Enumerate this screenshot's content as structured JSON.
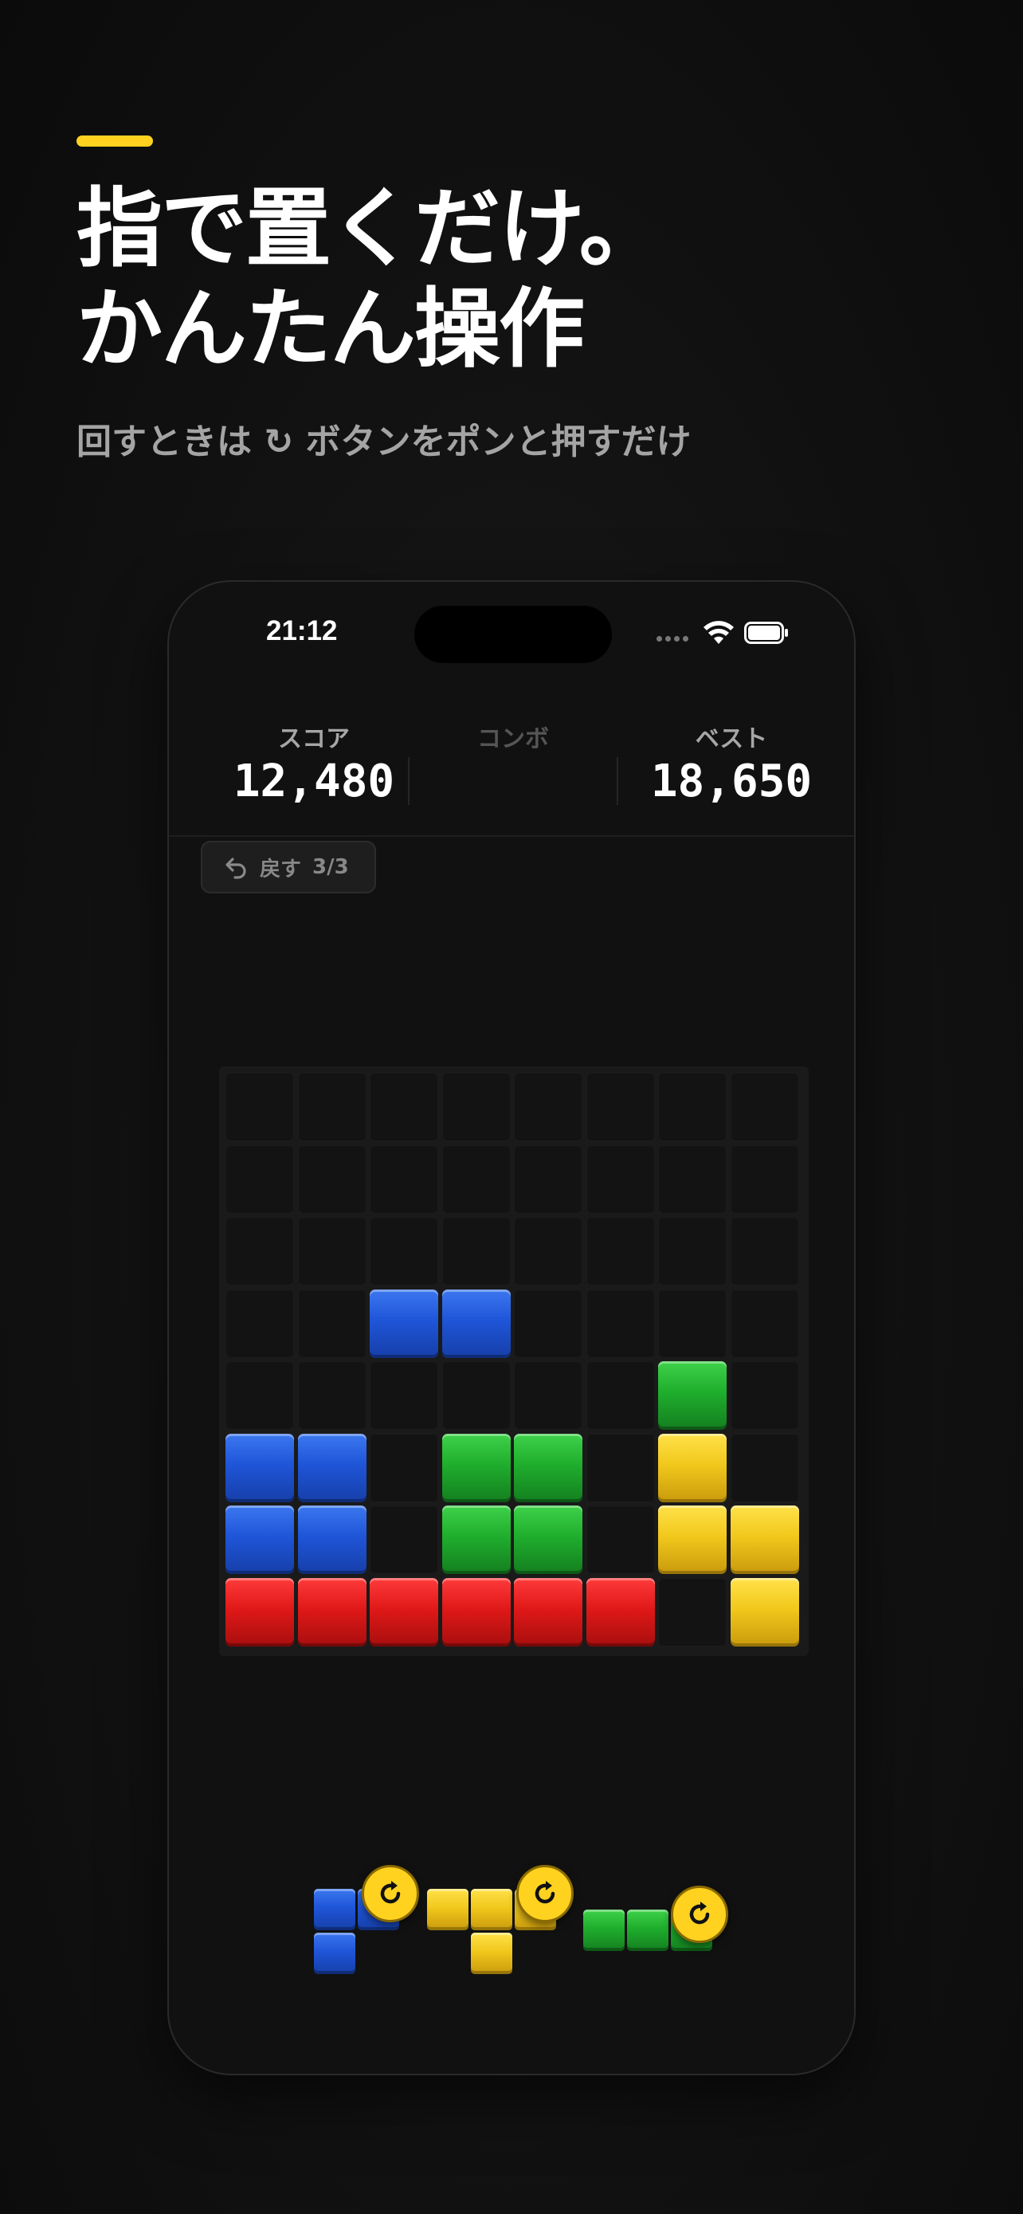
{
  "headline": {
    "line1": "指で置くだけ。",
    "line2": "かんたん操作"
  },
  "subtitle": "回すときは ↻ ボタンをポンと押すだけ",
  "colors": {
    "accent": "#ffd21f",
    "blue": "#1f55d8",
    "green": "#1fae2d",
    "yellow": "#f1c81c",
    "red": "#e01818",
    "background": "#111111"
  },
  "status_bar": {
    "time": "21:12",
    "icons": [
      "signal-icon",
      "wifi-icon",
      "battery-icon"
    ]
  },
  "scores": {
    "score_label": "スコア",
    "score_value": "12,480",
    "combo_label": "コンボ",
    "best_label": "ベスト",
    "best_value": "18,650"
  },
  "undo": {
    "label": "戻す",
    "count": "3/3",
    "icon": "undo-icon"
  },
  "board": {
    "size": 8,
    "rows": [
      "........",
      "........",
      "........",
      "..BB....",
      "......G..",
      "BB.GG.Y.",
      "BB.GG.YY",
      "RRRRRR.Y"
    ]
  },
  "tray": {
    "pieces": [
      {
        "color": "blue",
        "shape": [
          "XX",
          "X."
        ],
        "rotate_icon": "rotate-icon"
      },
      {
        "color": "yellow",
        "shape": [
          "XXX",
          ".X."
        ],
        "rotate_icon": "rotate-icon"
      },
      {
        "color": "green",
        "shape": [
          "XXX"
        ],
        "rotate_icon": "rotate-icon"
      }
    ]
  }
}
